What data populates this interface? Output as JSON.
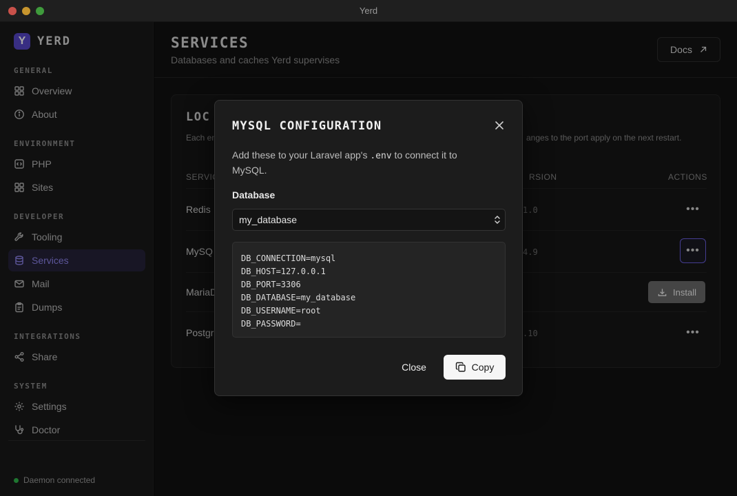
{
  "window": {
    "title": "Yerd"
  },
  "brand": {
    "logo_letter": "Y",
    "name": "YERD",
    "accent": "#5648c9"
  },
  "sidebar": {
    "sections": [
      {
        "label": "GENERAL"
      },
      {
        "label": "ENVIRONMENT"
      },
      {
        "label": "DEVELOPER"
      },
      {
        "label": "INTEGRATIONS"
      },
      {
        "label": "SYSTEM"
      }
    ],
    "items": [
      {
        "label": "Overview",
        "icon": "grid-icon"
      },
      {
        "label": "About",
        "icon": "info-icon"
      },
      {
        "label": "PHP",
        "icon": "code-icon"
      },
      {
        "label": "Sites",
        "icon": "grid-icon"
      },
      {
        "label": "Tooling",
        "icon": "wrench-icon"
      },
      {
        "label": "Services",
        "icon": "database-icon",
        "active": true
      },
      {
        "label": "Mail",
        "icon": "mail-icon"
      },
      {
        "label": "Dumps",
        "icon": "clipboard-icon"
      },
      {
        "label": "Share",
        "icon": "share-icon"
      },
      {
        "label": "Settings",
        "icon": "gear-icon"
      },
      {
        "label": "Doctor",
        "icon": "stethoscope-icon"
      }
    ],
    "status": "Daemon connected",
    "status_color": "#2fb64b"
  },
  "header": {
    "title": "SERVICES",
    "subtitle": "Databases and caches Yerd supervises",
    "docs_label": "Docs"
  },
  "panel": {
    "title": "LOC",
    "desc_left": "Each en",
    "desc_right": "anges to the port apply on the next restart.",
    "columns": {
      "service": "SERVIC",
      "version": "RSION",
      "actions": "ACTIONS"
    },
    "rows": [
      {
        "name": "Redis",
        "version": "1.0"
      },
      {
        "name": "MySQ",
        "version": "4.9"
      },
      {
        "name": "MariaD",
        "version": "",
        "action": "Install"
      },
      {
        "name": "Postgr",
        "version": ".10"
      }
    ]
  },
  "modal": {
    "title": "MYSQL CONFIGURATION",
    "text_before": "Add these to your Laravel app's ",
    "text_code": ".env",
    "text_after": " to connect it to MySQL.",
    "field_label": "Database",
    "selected_database": "my_database",
    "env_lines": [
      "DB_CONNECTION=mysql",
      "DB_HOST=127.0.0.1",
      "DB_PORT=3306",
      "DB_DATABASE=my_database",
      "DB_USERNAME=root",
      "DB_PASSWORD="
    ],
    "close_label": "Close",
    "copy_label": "Copy"
  }
}
